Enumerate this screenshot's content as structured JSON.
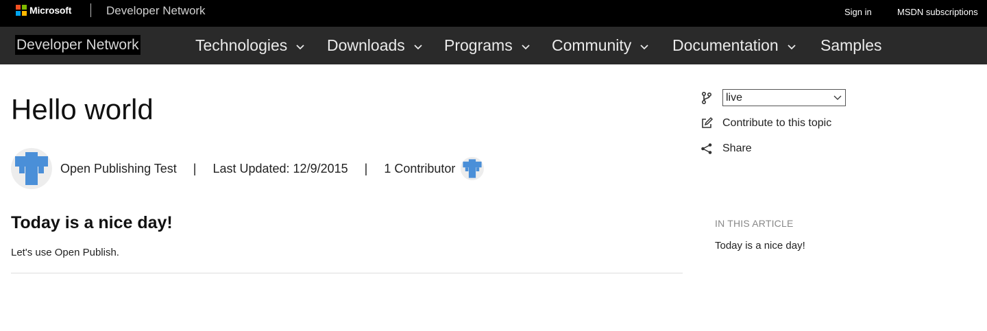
{
  "topbar": {
    "brand_name": "Microsoft",
    "logo_colors": [
      "#f25022",
      "#7fba00",
      "#00a4ef",
      "#ffb900"
    ],
    "site_name": "Developer Network",
    "sign_in": "Sign in",
    "subscriptions": "MSDN subscriptions"
  },
  "navbar": {
    "brand": "Developer Network",
    "items": [
      {
        "label": "Technologies",
        "has_dropdown": true
      },
      {
        "label": "Downloads",
        "has_dropdown": true
      },
      {
        "label": "Programs",
        "has_dropdown": true
      },
      {
        "label": "Community",
        "has_dropdown": true
      },
      {
        "label": "Documentation",
        "has_dropdown": true
      },
      {
        "label": "Samples",
        "has_dropdown": false
      }
    ]
  },
  "article": {
    "title": "Hello world",
    "author": "Open Publishing Test",
    "separator": "|",
    "last_updated": "Last Updated: 12/9/2015",
    "contributors": "1 Contributor",
    "heading": "Today is a nice day!",
    "body": "Let's use Open Publish."
  },
  "sidebar": {
    "branch_value": "live",
    "contribute": "Contribute to this topic",
    "share": "Share",
    "toc_header": "IN THIS ARTICLE",
    "toc_items": [
      "Today is a nice day!"
    ]
  },
  "colors": {
    "avatar_blue": "#4a8fd8",
    "nav_bg": "#2a2a2a",
    "top_bg": "#000000"
  },
  "icons": [
    "microsoft-logo-icon",
    "chevron-down-icon",
    "branch-icon",
    "edit-icon",
    "share-icon",
    "avatar-cross-icon"
  ]
}
